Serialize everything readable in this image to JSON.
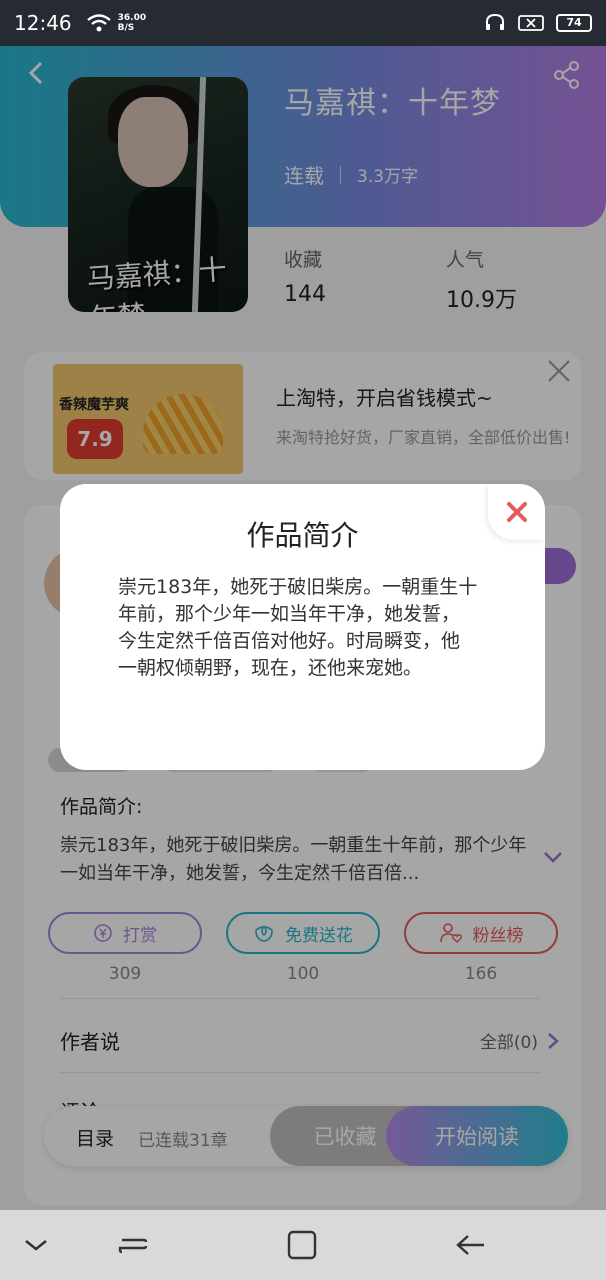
{
  "status": {
    "time": "12:46",
    "speed_value": "36.00",
    "speed_unit": "B/S",
    "battery": "74"
  },
  "book": {
    "cover_text": "马嘉祺：十年梦",
    "title": "马嘉祺：十年梦",
    "state": "连载",
    "words": "3.3万字",
    "collect_label": "收藏",
    "collect_value": "144",
    "popularity_label": "人气",
    "popularity_value": "10.9万"
  },
  "ad": {
    "product_label": "香辣魔芋爽",
    "price": "7.9",
    "title": "上淘特，开启省钱模式~",
    "subtitle": "来淘特抢好货，厂家直销，全部低价出售!"
  },
  "intro": {
    "heading": "作品简介:",
    "text": "崇元183年，她死于破旧柴房。一朝重生十年前，那个少年一如当年干净，她发誓，今生定然千倍百倍..."
  },
  "actions": [
    {
      "label": "打赏",
      "count": "309",
      "color": "#a784dc"
    },
    {
      "label": "免费送花",
      "count": "100",
      "color": "#27b5cc"
    },
    {
      "label": "粉丝榜",
      "count": "166",
      "color": "#e65a5a"
    }
  ],
  "author_say": {
    "label": "作者说",
    "more": "全部(0)"
  },
  "comments": {
    "label": "评论"
  },
  "bottom": {
    "toc": "目录",
    "chapters": "已连载31章",
    "favorited": "已收藏",
    "start_reading": "开始阅读"
  },
  "modal": {
    "title": "作品简介",
    "text": "崇元183年，她死于破旧柴房。一朝重生十年前，那个少年一如当年干净，她发誓，今生定然千倍百倍对他好。时局瞬变，他一朝权倾朝野，现在，还他来宠她。"
  },
  "icons": {
    "accent": "#9a6fd6",
    "close_color": "#e55a5a"
  }
}
